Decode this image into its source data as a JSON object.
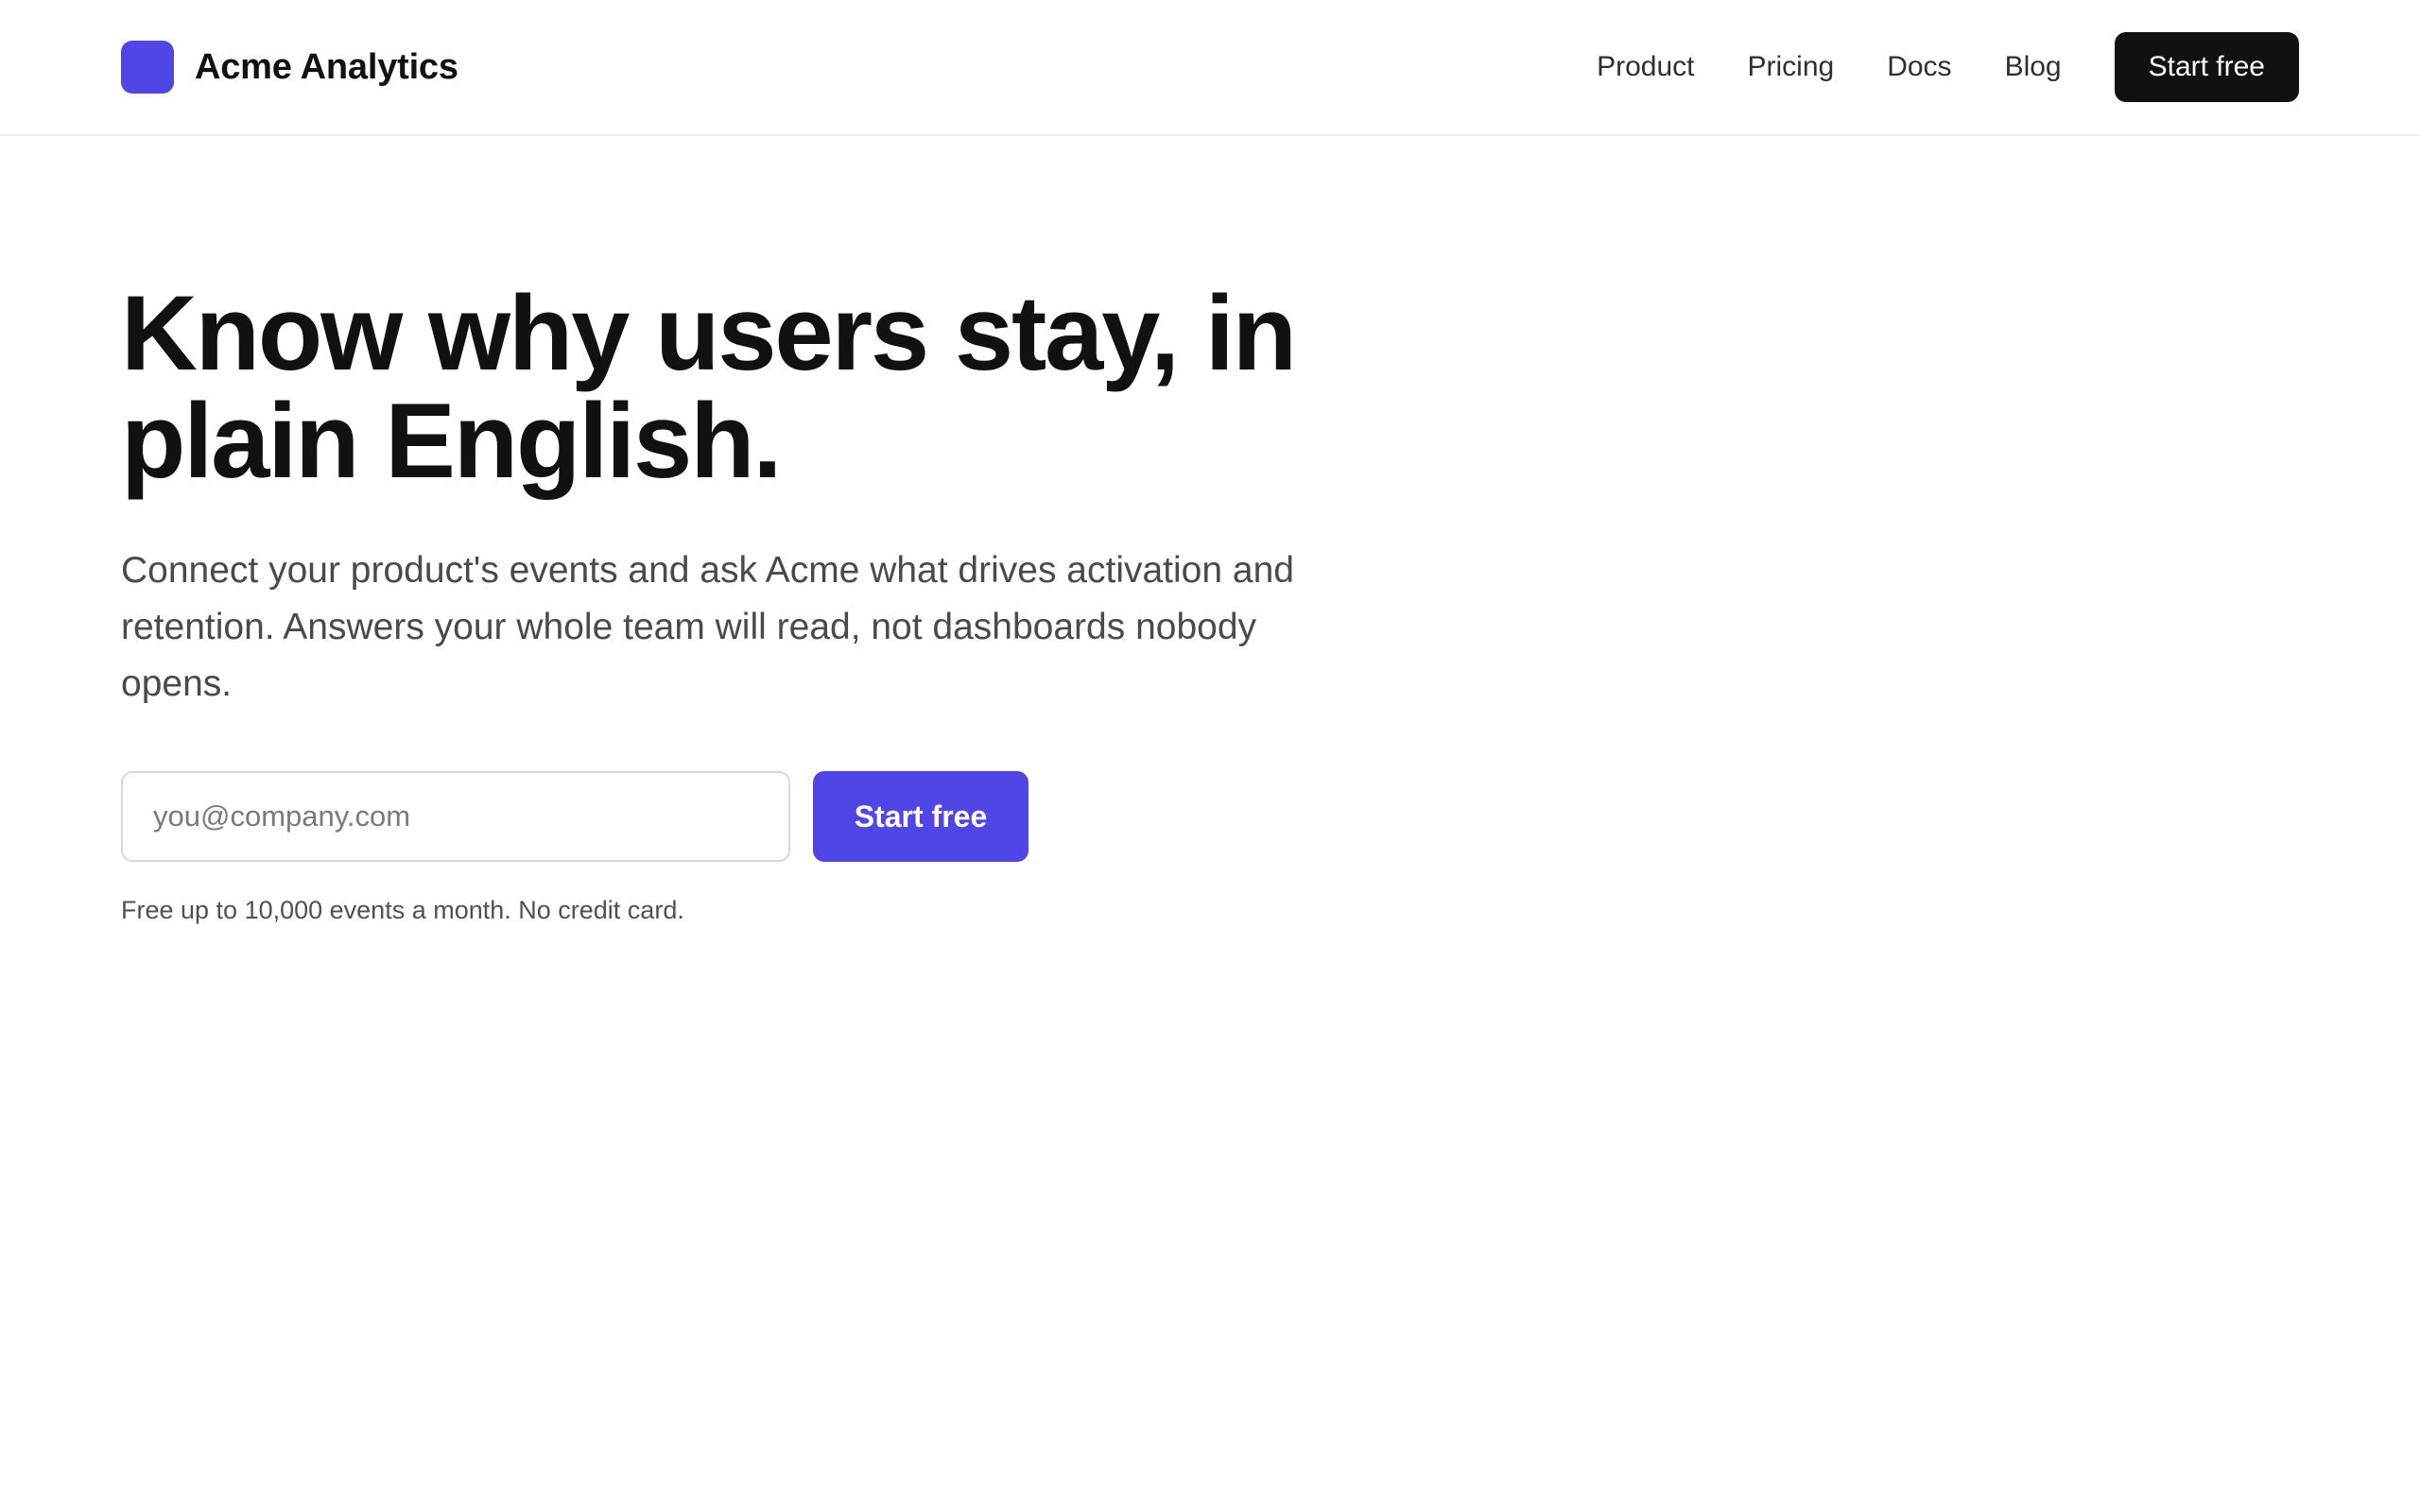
{
  "header": {
    "brand": "Acme Analytics",
    "nav": [
      {
        "label": "Product"
      },
      {
        "label": "Pricing"
      },
      {
        "label": "Docs"
      },
      {
        "label": "Blog"
      }
    ],
    "cta": "Start free"
  },
  "hero": {
    "title": "Know why users stay, in plain English.",
    "subtitle": "Connect your product's events and ask Acme what drives activation and retention. Answers your whole team will read, not dashboards nobody opens.",
    "email_placeholder": "you@company.com",
    "email_value": "",
    "cta": "Start free",
    "note": "Free up to 10,000 events a month. No credit card."
  },
  "colors": {
    "brand": "#4f46e5",
    "dark": "#111111"
  },
  "icons": {
    "brand_mark": "brand-logo-icon"
  }
}
